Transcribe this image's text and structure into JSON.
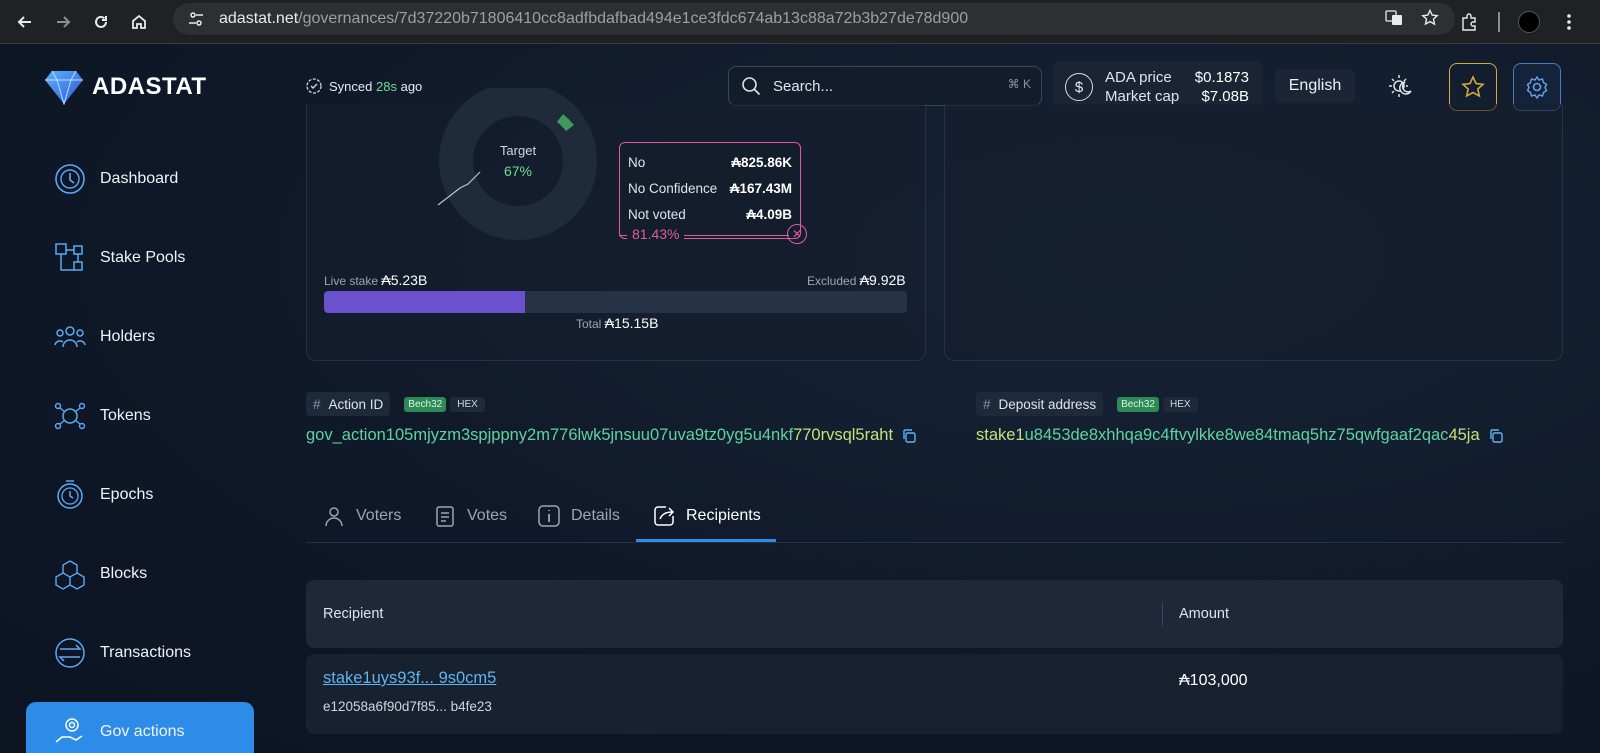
{
  "browser": {
    "url_host": "adastat.net",
    "url_path": "/governances/7d37220b71806410cc8adfbdafbad494e1ce3fdc674ab13c88a72b3b27de78d900"
  },
  "header": {
    "brand": "ADASTAT",
    "synced_prefix": "Synced",
    "synced_value": "28s",
    "synced_suffix": "ago",
    "search_placeholder": "Search...",
    "search_shortcut": "⌘ K",
    "ada_price_label": "ADA price",
    "ada_price_value": "$0.1873",
    "market_cap_label": "Market cap",
    "market_cap_value": "$7.08B",
    "language": "English"
  },
  "sidebar": {
    "items": [
      {
        "label": "Dashboard",
        "icon": "dashboard-icon"
      },
      {
        "label": "Stake Pools",
        "icon": "stake-pools-icon"
      },
      {
        "label": "Holders",
        "icon": "holders-icon"
      },
      {
        "label": "Tokens",
        "icon": "tokens-icon"
      },
      {
        "label": "Epochs",
        "icon": "epochs-icon"
      },
      {
        "label": "Blocks",
        "icon": "blocks-icon"
      },
      {
        "label": "Transactions",
        "icon": "transactions-icon"
      },
      {
        "label": "Gov actions",
        "icon": "gov-actions-icon",
        "active": true
      }
    ]
  },
  "vote_chart": {
    "target_label": "Target",
    "target_value": "67%",
    "tooltip": [
      {
        "label": "No",
        "value": "₳825.86K"
      },
      {
        "label": "No Confidence",
        "value": "₳167.43M"
      },
      {
        "label": "Not voted",
        "value": "₳4.09B"
      }
    ],
    "tooltip_pct": "81.43%",
    "live_stake_label": "Live stake",
    "live_stake_value": "₳5.23B",
    "excluded_label": "Excluded",
    "excluded_value": "₳9.92B",
    "total_label": "Total",
    "total_value": "₳15.15B",
    "live_fraction": 0.345
  },
  "action_id": {
    "label": "Action ID",
    "bech32": "Bech32",
    "hex": "HEX",
    "value_main": "gov_action105mjyzm3spjppny2m776lwk5jnsuu07uva9tz0yg5u4nkf",
    "value_tail": "770rvsql5raht"
  },
  "deposit_address": {
    "label": "Deposit address",
    "bech32": "Bech32",
    "hex": "HEX",
    "value_head": "stake1",
    "value_main": "u8453de8xhhqa9c4ftvylkke8we84tmaq5hz75qwfgaaf2qac",
    "value_tail": "45ja"
  },
  "tabs": [
    {
      "label": "Voters"
    },
    {
      "label": "Votes"
    },
    {
      "label": "Details"
    },
    {
      "label": "Recipients",
      "active": true
    }
  ],
  "recipients_table": {
    "headers": [
      "Recipient",
      "Amount"
    ],
    "rows": [
      {
        "address": "stake1uys93f... 9s0cm5",
        "hex": "e12058a6f90d7f85... b4fe23",
        "amount": "₳103,000"
      }
    ]
  },
  "colors": {
    "accent": "#2d8ce8",
    "live_stake_bar": "#6a52cf",
    "no_vote": "#e05aa3",
    "id_green": "#5fd39f"
  }
}
